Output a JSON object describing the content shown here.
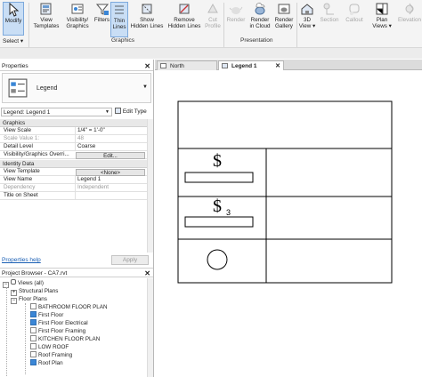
{
  "ribbon": {
    "modify": "Modify",
    "select": "Select ▾",
    "buttons": [
      {
        "l1": "View",
        "l2": "Templates"
      },
      {
        "l1": "Visibility/",
        "l2": "Graphics"
      },
      {
        "l1": "Filters",
        "l2": ""
      },
      {
        "l1": "Thin",
        "l2": "Lines"
      },
      {
        "l1": "Show",
        "l2": "Hidden Lines"
      },
      {
        "l1": "Remove",
        "l2": "Hidden Lines"
      },
      {
        "l1": "Cut",
        "l2": "Profile"
      },
      {
        "l1": "Render",
        "l2": ""
      },
      {
        "l1": "Render",
        "l2": "in Cloud"
      },
      {
        "l1": "Render",
        "l2": "Gallery"
      },
      {
        "l1": "3D",
        "l2": "View ▾"
      },
      {
        "l1": "Section",
        "l2": ""
      },
      {
        "l1": "Callout",
        "l2": ""
      },
      {
        "l1": "Plan",
        "l2": "Views ▾"
      },
      {
        "l1": "Elevation",
        "l2": ""
      }
    ],
    "groups": {
      "graphics": "Graphics",
      "presentation": "Presentation"
    }
  },
  "properties": {
    "title": "Properties",
    "type_name": "Legend",
    "selector": "Legend: Legend 1",
    "edit_type": "Edit Type",
    "groups": {
      "graphics": "Graphics",
      "identity": "Identity Data"
    },
    "rows": [
      {
        "k": "View Scale",
        "v": "1/4\" = 1'-0\""
      },
      {
        "k": "Scale Value    1:",
        "v": "48"
      },
      {
        "k": "Detail Level",
        "v": "Coarse"
      },
      {
        "k": "Visibility/Graphics Overri...",
        "v": "Edit..."
      },
      {
        "k": "View Template",
        "v": "<None>"
      },
      {
        "k": "View Name",
        "v": "Legend 1"
      },
      {
        "k": "Dependency",
        "v": "Independent"
      },
      {
        "k": "Title on Sheet",
        "v": ""
      }
    ],
    "help": "Properties help",
    "apply": "Apply"
  },
  "browser": {
    "title": "Project Browser - CA7.rvt",
    "views": "Views (all)",
    "structural": "Structural Plans",
    "floor": "Floor Plans",
    "items": [
      "BATHROOM FLOOR PLAN",
      "First Floor",
      "First Floor Electrical",
      "First Floor Framing",
      "KITCHEN FLOOR PLAN",
      "LOW ROOF",
      "Roof Framing",
      "Roof Plan"
    ]
  },
  "tabs": [
    "North",
    "Legend 1"
  ],
  "legend": {
    "switch_label": "3"
  }
}
